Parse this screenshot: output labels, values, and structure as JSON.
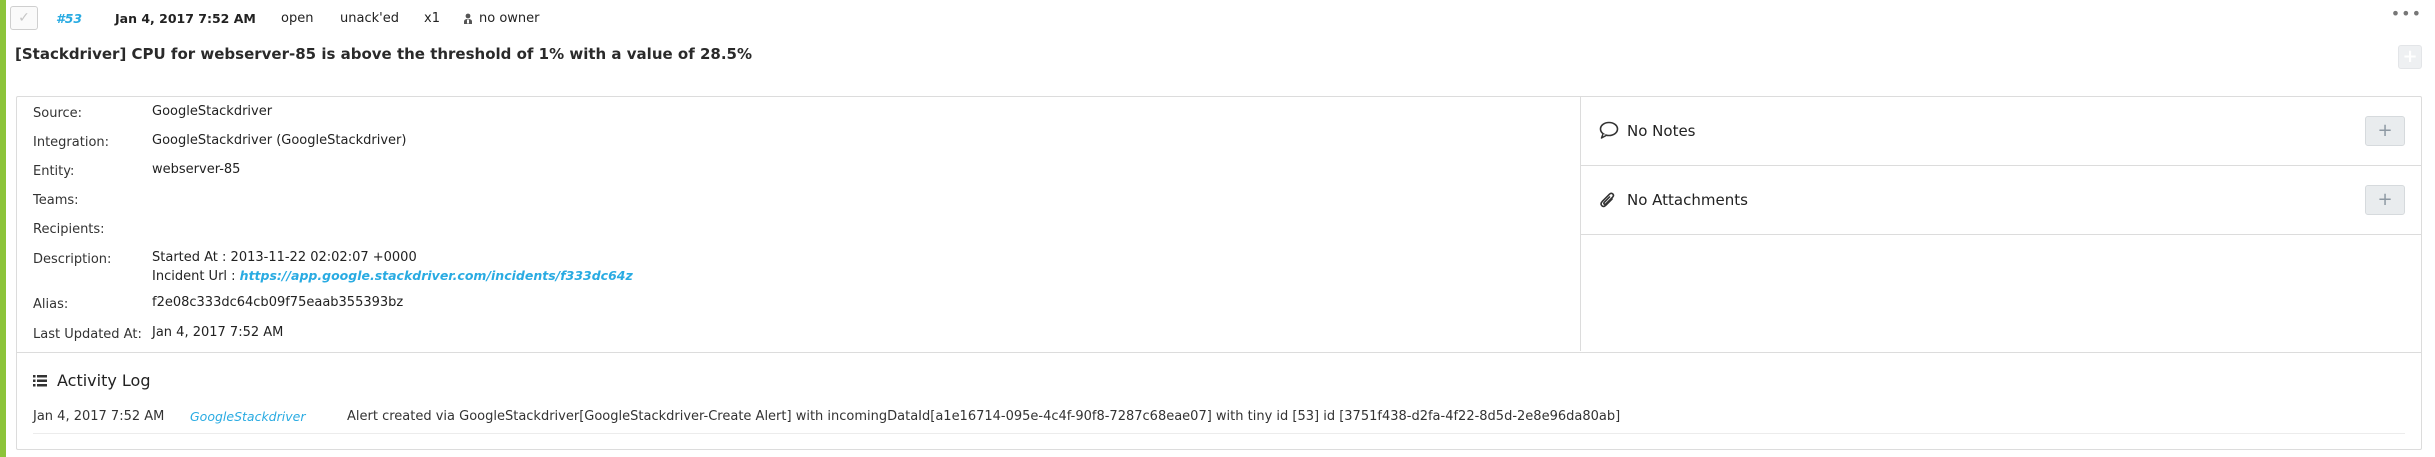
{
  "colors": {
    "accent_bar": "#8cc43a",
    "link": "#29abe2"
  },
  "alert": {
    "tiny_id": "#53",
    "created_at": "Jan 4, 2017 7:52 AM",
    "status": "open",
    "ack_state": "unack'ed",
    "count": "x1",
    "owner": "no owner",
    "more_label": "•••",
    "message": "[Stackdriver] CPU for webserver-85 is above the threshold of 1% with a value of 28.5%"
  },
  "details": {
    "source": {
      "label": "Source:",
      "value": "GoogleStackdriver"
    },
    "integration": {
      "label": "Integration:",
      "value": "GoogleStackdriver (GoogleStackdriver)"
    },
    "entity": {
      "label": "Entity:",
      "value": "webserver-85"
    },
    "teams": {
      "label": "Teams:",
      "value": ""
    },
    "recipients": {
      "label": "Recipients:",
      "value": ""
    },
    "description": {
      "label": "Description:",
      "line1": "Started At : 2013-11-22 02:02:07 +0000",
      "line2_prefix": "Incident Url : ",
      "line2_link": "https://app.google.stackdriver.com/incidents/f333dc64z"
    },
    "alias": {
      "label": "Alias:",
      "value": "f2e08c333dc64cb09f75eaab355393bz"
    },
    "last_updated": {
      "label": "Last Updated At:",
      "value": "Jan 4, 2017 7:52 AM"
    }
  },
  "notes": {
    "label": "No Notes",
    "icon": "speech-bubble-icon",
    "add_label": "+"
  },
  "attachments": {
    "label": "No Attachments",
    "icon": "paperclip-icon",
    "add_label": "+"
  },
  "activity_log": {
    "title": "Activity Log",
    "icon": "list-icon",
    "entries": [
      {
        "date": "Jan 4, 2017 7:52 AM",
        "user": "GoogleStackdriver",
        "message": "Alert created via GoogleStackdriver[GoogleStackdriver-Create Alert] with incomingDataId[a1e16714-095e-4c4f-90f8-7287c68eae07] with tiny id [53] id [3751f438-d2fa-4f22-8d5d-2e8e96da80ab]"
      }
    ]
  }
}
